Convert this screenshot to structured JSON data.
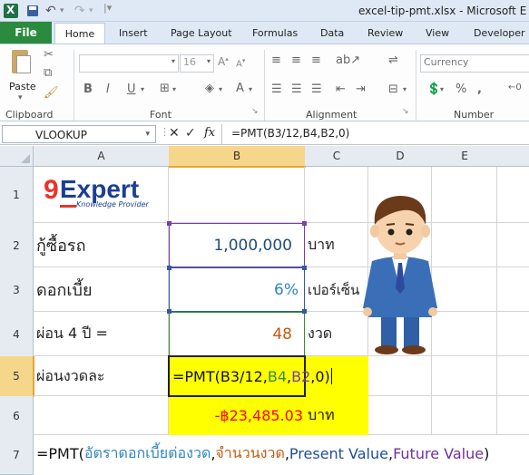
{
  "window": {
    "title": "excel-tip-pmt.xlsx - Microsoft E"
  },
  "tabs": {
    "file": "File",
    "home": "Home",
    "insert": "Insert",
    "page_layout": "Page Layout",
    "formulas": "Formulas",
    "data": "Data",
    "review": "Review",
    "view": "View",
    "developer": "Developer"
  },
  "ribbon": {
    "clipboard_label": "Clipboard",
    "paste_label": "Paste",
    "font_label": "Font",
    "alignment_label": "Alignment",
    "number_label": "Number",
    "font_size": "16",
    "number_format": "Currency"
  },
  "formula_bar": {
    "name_box": "VLOOKUP",
    "fx": "fx",
    "formula": "=PMT(B3/12,B4,B2,0)"
  },
  "columns": [
    "A",
    "B",
    "C",
    "D",
    "E"
  ],
  "rows": [
    "1",
    "2",
    "3",
    "4",
    "5",
    "6",
    "7"
  ],
  "logo": {
    "brand_9": "9",
    "brand_expert": "Expert",
    "tagline": "Knowledge Provider"
  },
  "cells": {
    "a2": "กู้ซื้อรถ",
    "b2": "1,000,000",
    "c2": "บาท",
    "a3": "ดอกเบี้ย",
    "b3": "6%",
    "c3": "เปอร์เซ็น",
    "a4": "ผ่อน 4 ปี =",
    "b4": "48",
    "c4": "งวด",
    "a5": "ผ่อนงวดละ",
    "b5_parts": [
      "=PMT(B3/12,",
      "B4",
      ",",
      "B2",
      ",0)"
    ],
    "b6": "-฿23,485.03",
    "c6": "บาท",
    "a7_parts": [
      "=PMT(",
      "อัตราดอกเบี้ยต่องวด",
      ", ",
      "จำนวนงวด",
      ", ",
      "Present Value",
      ", ",
      "Future Value",
      ")"
    ]
  },
  "colors": {
    "accent_green": "#2a8a3e",
    "highlight_yellow": "#ffff00",
    "b2_text": "#1f4e79",
    "b3_text": "#2e86c1",
    "b4_text": "#c55a11",
    "b6_text": "#ff0000",
    "rate_color": "#2e86c1",
    "periods_color": "#c55a11",
    "pv_color": "#1f4e9c",
    "fv_color": "#7030a0"
  }
}
